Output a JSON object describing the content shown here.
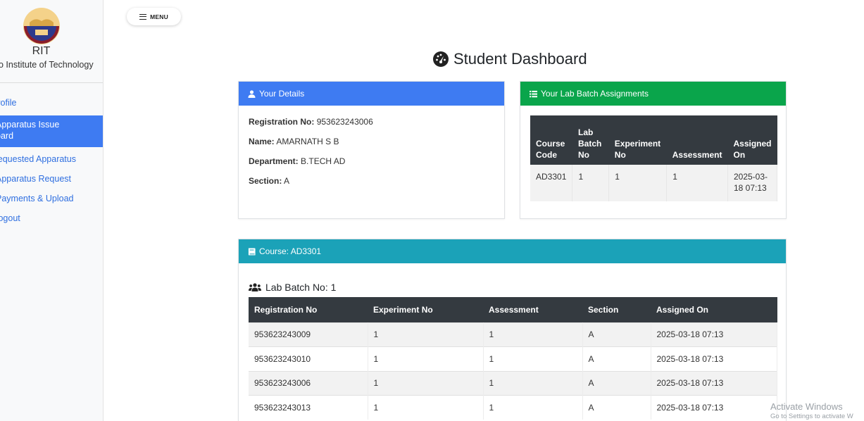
{
  "sidebar": {
    "org_short": "RIT",
    "org_long": "o Institute of Technology",
    "items": [
      {
        "label": "'rofile"
      },
      {
        "label_line1": "Apparatus Issue",
        "label_line2": "oard"
      },
      {
        "label": "lequested Apparatus"
      },
      {
        "label": "Apparatus Request"
      },
      {
        "label": "Payments & Upload"
      },
      {
        "label": ".ogout"
      }
    ]
  },
  "menu_button": {
    "label": "MENU"
  },
  "page_title": "Student Dashboard",
  "details_card": {
    "header": "Your Details",
    "fields": [
      {
        "label": "Registration No:",
        "value": "953623243006"
      },
      {
        "label": "Name:",
        "value": "AMARNATH S B"
      },
      {
        "label": "Department:",
        "value": "B.TECH AD"
      },
      {
        "label": "Section:",
        "value": "A"
      }
    ]
  },
  "batch_card": {
    "header": "Your Lab Batch Assignments",
    "columns": [
      "Course Code",
      "Lab Batch No",
      "Experiment No",
      "Assessment",
      "Assigned On"
    ],
    "rows": [
      {
        "course_code": "AD3301",
        "lab_batch_no": "1",
        "experiment_no": "1",
        "assessment": "1",
        "assigned_on": "2025-03-18 07:13"
      }
    ]
  },
  "course_card": {
    "header": "Course: AD3301",
    "lab_batch_title": "Lab Batch No: 1",
    "columns": [
      "Registration No",
      "Experiment No",
      "Assessment",
      "Section",
      "Assigned On"
    ],
    "rows": [
      {
        "registration_no": "953623243009",
        "experiment_no": "1",
        "assessment": "1",
        "section": "A",
        "assigned_on": "2025-03-18 07:13"
      },
      {
        "registration_no": "953623243010",
        "experiment_no": "1",
        "assessment": "1",
        "section": "A",
        "assigned_on": "2025-03-18 07:13"
      },
      {
        "registration_no": "953623243006",
        "experiment_no": "1",
        "assessment": "1",
        "section": "A",
        "assigned_on": "2025-03-18 07:13"
      },
      {
        "registration_no": "953623243013",
        "experiment_no": "1",
        "assessment": "1",
        "section": "A",
        "assigned_on": "2025-03-18 07:13"
      }
    ]
  },
  "watermark": {
    "line1": "Activate Windows",
    "line2": "Go to Settings to activate W"
  },
  "colors": {
    "blue": "#3e7bf2",
    "green": "#0aa54b",
    "teal": "#1ba2b8",
    "table_header": "#343a40"
  },
  "icons": {
    "title": "tachometer-icon",
    "details": "user-icon",
    "batch": "list-icon",
    "course": "book-icon",
    "lab_batch": "users-icon",
    "menu": "hamburger-icon"
  }
}
